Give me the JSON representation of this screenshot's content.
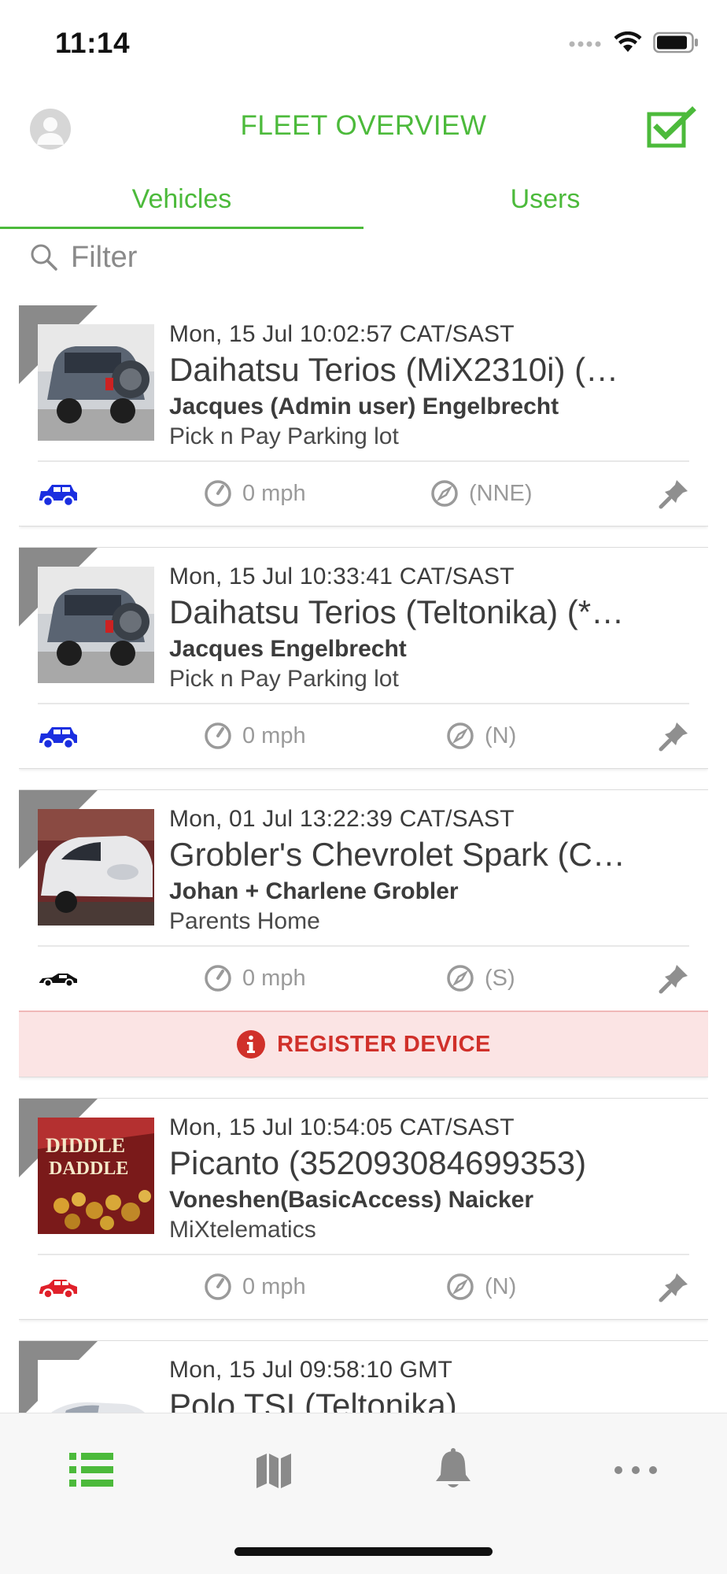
{
  "status_bar": {
    "time": "11:14"
  },
  "nav": {
    "title": "FLEET OVERVIEW"
  },
  "tabs": [
    {
      "label": "Vehicles",
      "selected": true
    },
    {
      "label": "Users",
      "selected": false
    }
  ],
  "filter": {
    "placeholder": "Filter",
    "value": ""
  },
  "vehicles": [
    {
      "timestamp": "Mon, 15 Jul 10:02:57 CAT/SAST",
      "name": "Daihatsu Terios (MiX2310i) (…",
      "driver": "Jacques (Admin user) Engelbrecht",
      "location": "Pick n Pay Parking lot",
      "speed": "0 mph",
      "heading": "(NNE)",
      "vehicle_icon": "suv-icon",
      "vehicle_icon_color": "#1a2ee0",
      "image": "grey-suv-photo"
    },
    {
      "timestamp": "Mon, 15 Jul 10:33:41 CAT/SAST",
      "name": "Daihatsu Terios (Teltonika) (*…",
      "driver": "Jacques Engelbrecht",
      "location": "Pick n Pay Parking lot",
      "speed": "0 mph",
      "heading": "(N)",
      "vehicle_icon": "suv-icon",
      "vehicle_icon_color": "#1a2ee0",
      "image": "grey-suv-photo"
    },
    {
      "timestamp": "Mon, 01 Jul 13:22:39 CAT/SAST",
      "name": "Grobler's Chevrolet Spark (C…",
      "driver": "Johan + Charlene Grobler",
      "location": "Parents Home",
      "speed": "0 mph",
      "heading": "(S)",
      "vehicle_icon": "sports-car-icon",
      "vehicle_icon_color": "#111111",
      "image": "white-hatchback-photo",
      "register_label": "REGISTER DEVICE"
    },
    {
      "timestamp": "Mon, 15 Jul 10:54:05 CAT/SAST",
      "name": "Picanto (352093084699353)",
      "driver": "Voneshen(BasicAccess) Naicker",
      "location": "MiXtelematics",
      "speed": "0 mph",
      "heading": "(N)",
      "vehicle_icon": "sedan-icon",
      "vehicle_icon_color": "#e0202a",
      "image": "snack-bag-photo"
    },
    {
      "timestamp": "Mon, 15 Jul 09:58:10 GMT",
      "name": "Polo TSI (Teltonika)",
      "image": "white-sedan-photo"
    }
  ],
  "tab_bar": [
    {
      "icon": "list-icon",
      "active": true
    },
    {
      "icon": "map-icon",
      "active": false
    },
    {
      "icon": "bell-icon",
      "active": false
    },
    {
      "icon": "more-icon",
      "active": false
    }
  ],
  "colors": {
    "accent": "#4cba3b",
    "alert": "#d0302a",
    "alert_bg": "#fbe4e4"
  }
}
